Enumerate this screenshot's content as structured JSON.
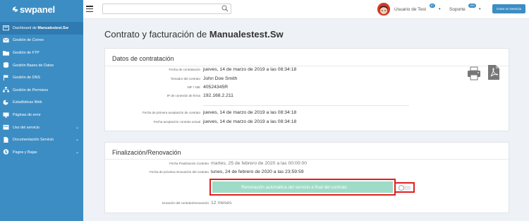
{
  "brand": {
    "name": "swpanel"
  },
  "sidebar": {
    "items": [
      {
        "label": "Dashboard de ",
        "label_bold": "Manualestest.Sw",
        "icon": "dashboard-icon",
        "active": true,
        "chevron": false
      },
      {
        "label": "Gestión de Correo",
        "icon": "mail-icon",
        "chevron": false
      },
      {
        "label": "Gestión de FTP",
        "icon": "folder-icon",
        "chevron": false
      },
      {
        "label": "Gestión Bases de Datos",
        "icon": "database-icon",
        "chevron": false
      },
      {
        "label": "Gestión de DNS",
        "icon": "flag-icon",
        "chevron": false
      },
      {
        "label": "Gestión de Permisos",
        "icon": "sitemap-icon",
        "chevron": false
      },
      {
        "label": "Estadísticas Web",
        "icon": "chart-icon",
        "chevron": false
      },
      {
        "label": "Páginas de error",
        "icon": "monitor-icon",
        "chevron": false
      },
      {
        "label": "Uso del servicio",
        "icon": "calendar-icon",
        "chevron": true
      },
      {
        "label": "Documentación Servicio",
        "icon": "document-icon",
        "chevron": true
      },
      {
        "label": "Pagos y Bajas",
        "icon": "dollar-icon",
        "chevron": true
      }
    ]
  },
  "topbar": {
    "search_placeholder": "",
    "user_label": "Usuario de Test",
    "user_badge": "87",
    "support_label": "Soporte",
    "support_badge": "100",
    "new_service_label": "Crear un Servicio"
  },
  "page": {
    "title_prefix": "Contrato y facturación de ",
    "title_domain": "Manualestest.Sw"
  },
  "contract": {
    "title": "Datos de contratación",
    "rows": [
      {
        "label": "Fecha de contratación",
        "value": "jueves, 14 de marzo de 2019 a las 08:34:18"
      },
      {
        "label": "Tomador del contrato",
        "value": "John Doe Smith"
      },
      {
        "label": "NIF / NIE",
        "value": "40524345R"
      },
      {
        "label": "IP de conexión de firma",
        "value": "192.168.2.211"
      },
      {
        "label": "Fecha de primera aceptación de contrato",
        "value": "jueves, 14 de marzo de 2019 a las 08:34:18"
      },
      {
        "label": "Fecha aceptación contrato actual",
        "value": "jueves, 14 de marzo de 2019 a las 08:34:18"
      }
    ],
    "icons": {
      "print": "printer-icon",
      "pdf": "pdf-icon"
    }
  },
  "renewal": {
    "title": "Finalización/Renovación",
    "rows": [
      {
        "label": "Fecha Finalización Contrato",
        "value": "martes, 25 de febrero de 2020 a las 00:00:00"
      },
      {
        "label": "Fecha de próxima renovación del contrato",
        "value": "lunes, 24 de febrero de 2020 a las 23:59:59"
      }
    ],
    "auto_renew_label": "Renovación automática del servicio a final del contrato",
    "auto_renew_enabled": false,
    "duration_label": "Duración del contrato/renovación",
    "duration_value": "12 meses"
  },
  "colors": {
    "sidebar": "#3c8dc4",
    "renewal_bg": "#9fdcc7",
    "highlight": "#e02020"
  }
}
